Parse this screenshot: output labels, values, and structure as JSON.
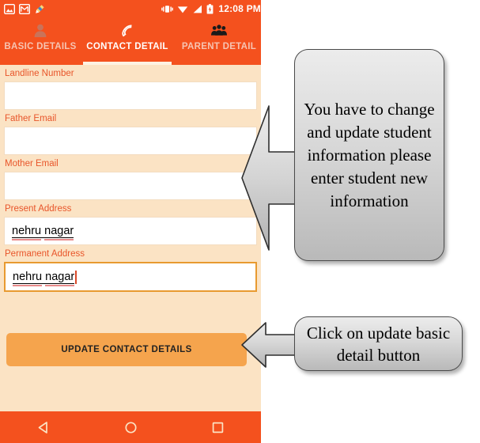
{
  "status_bar": {
    "icons_left": [
      "screenshot-icon",
      "gmail-icon",
      "cleaner-icon"
    ],
    "icons_right": [
      "vibrate-icon",
      "wifi-icon",
      "signal-icon",
      "battery-charging-icon"
    ],
    "clock": "12:08 PM"
  },
  "tabs": [
    {
      "label": "BASIC DETAILS",
      "icon": "person-icon",
      "active": false
    },
    {
      "label": "CONTACT DETAIL",
      "icon": "phone-icon",
      "active": true
    },
    {
      "label": "PARENT DETAIL",
      "icon": "group-icon",
      "active": false
    }
  ],
  "form": {
    "fields": [
      {
        "label": "Landline Number",
        "value": "",
        "focused": false,
        "misspelled": []
      },
      {
        "label": "Father Email",
        "value": "",
        "focused": false,
        "misspelled": []
      },
      {
        "label": "Mother Email",
        "value": "",
        "focused": false,
        "misspelled": []
      },
      {
        "label": "Present Address",
        "value": "nehru nagar",
        "focused": false,
        "misspelled": [
          "nehru",
          "nagar"
        ]
      },
      {
        "label": "Permanent Address",
        "value": "nehru nagar",
        "focused": true,
        "misspelled": [
          "nehru",
          "nagar"
        ]
      }
    ],
    "submit_label": "UPDATE CONTACT DETAILS"
  },
  "nav_bar": {
    "back": "back-triangle-icon",
    "home": "home-circle-icon",
    "recents": "recents-square-icon"
  },
  "callouts": [
    {
      "text": "You have to change and update student information please enter student new information"
    },
    {
      "text": "Click on update basic detail button"
    }
  ],
  "colors": {
    "primary_orange": "#F4511E",
    "form_background": "#FBE3C4",
    "label_orange": "#E8552A",
    "button_orange": "#F5A44D",
    "focus_border": "#E89A30",
    "spellcheck_red": "#E98B8B"
  }
}
